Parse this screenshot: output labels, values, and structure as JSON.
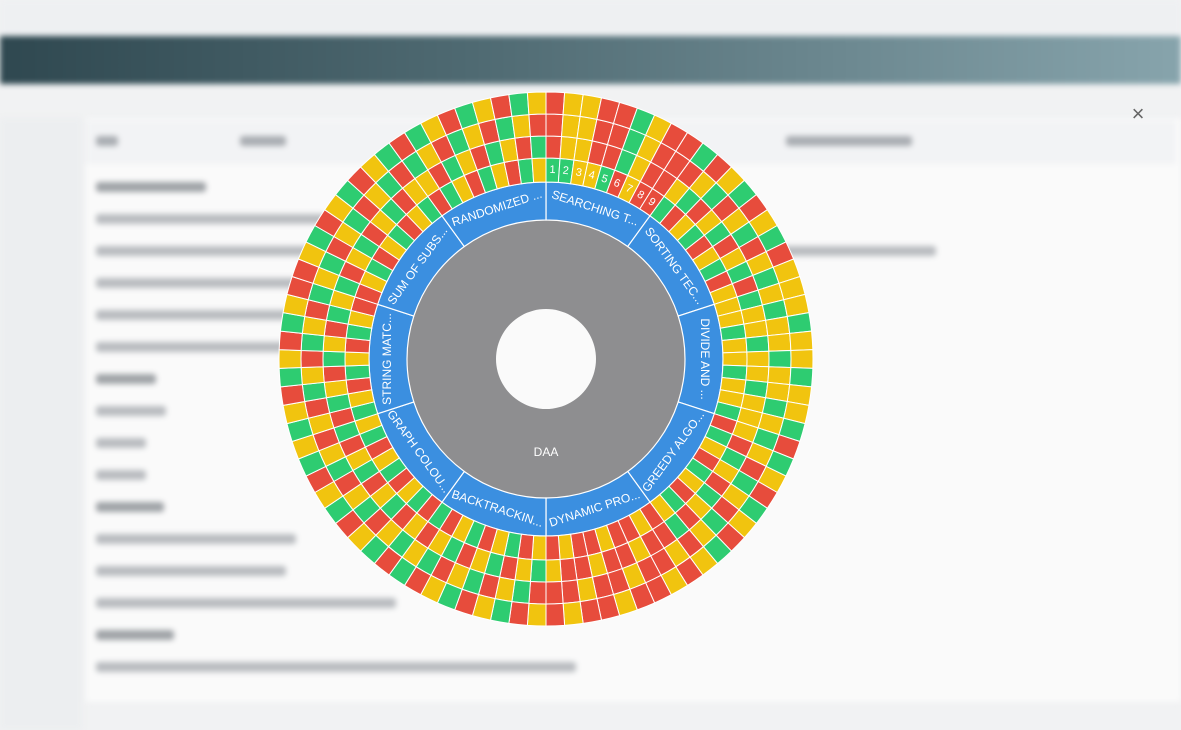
{
  "dialog": {
    "close_icon": "close-icon"
  },
  "colors": {
    "red": "#e74c3c",
    "yellow": "#f1c40f",
    "green": "#2ecc71",
    "blue": "#3b8fe0",
    "root": "#8e8e90"
  },
  "chart_data": {
    "type": "sunburst",
    "root": "DAA",
    "categories": [
      {
        "label": "SEARCHING T...",
        "rings": [
          [
            "green",
            "green",
            "yellow",
            "yellow",
            "green",
            "red",
            "yellow",
            "red",
            "red"
          ],
          [
            "red",
            "yellow",
            "yellow",
            "red",
            "red",
            "green",
            "yellow",
            "red",
            "red"
          ],
          [
            "red",
            "yellow",
            "yellow",
            "red",
            "red",
            "green",
            "yellow",
            "red",
            "red"
          ],
          [
            "red",
            "yellow",
            "yellow",
            "red",
            "red",
            "green",
            "yellow",
            "red",
            "red"
          ]
        ],
        "numbers": [
          "1",
          "2",
          "3",
          "4",
          "5",
          "6",
          "7",
          "8",
          "9"
        ]
      },
      {
        "label": "SORTING TEC...",
        "pattern": [
          "yellow",
          "green",
          "red"
        ]
      },
      {
        "label": "DIVIDE AND ...",
        "pattern": [
          "yellow",
          "green",
          "yellow"
        ]
      },
      {
        "label": "GREEDY ALGO...",
        "pattern": [
          "red",
          "green",
          "yellow"
        ]
      },
      {
        "label": "DYNAMIC PRO...",
        "pattern": [
          "red",
          "red",
          "yellow"
        ]
      },
      {
        "label": "BACKTRACKIN...",
        "pattern": [
          "red",
          "green",
          "yellow"
        ]
      },
      {
        "label": "GRAPH COLOU...",
        "pattern": [
          "red",
          "green",
          "yellow"
        ]
      },
      {
        "label": "STRING MATC...",
        "pattern": [
          "red",
          "green",
          "yellow"
        ]
      },
      {
        "label": "SUM OF SUBS...",
        "pattern": [
          "yellow",
          "green",
          "red"
        ]
      },
      {
        "label": "RANDOMIZED ...",
        "pattern": [
          "red",
          "green",
          "yellow"
        ]
      }
    ]
  }
}
